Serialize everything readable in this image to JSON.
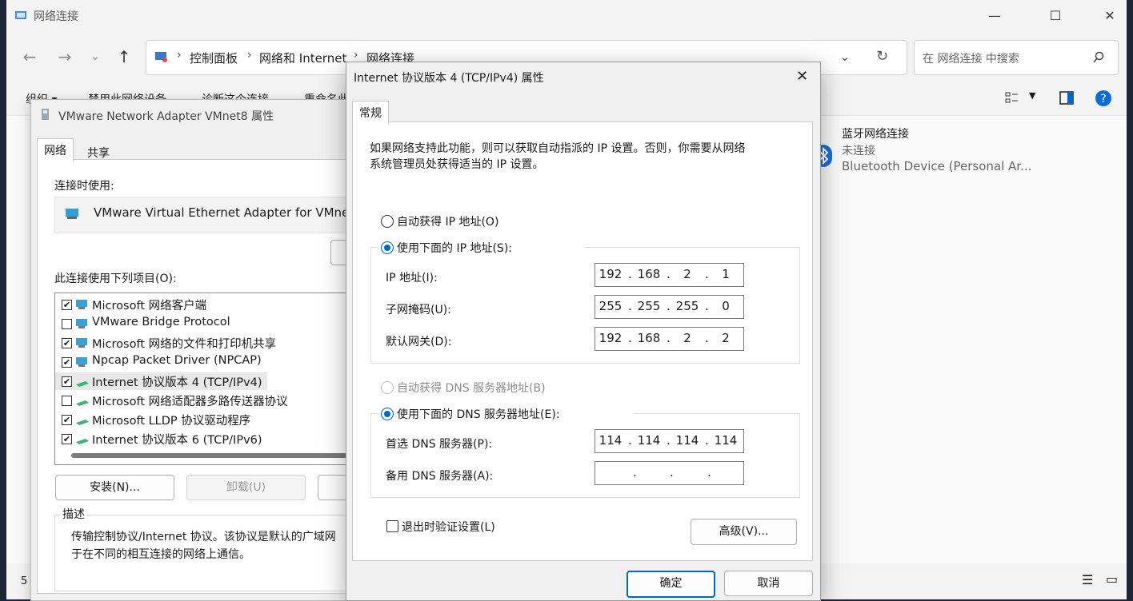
{
  "explorer": {
    "title": "网络连接",
    "breadcrumb": [
      "控制面板",
      "网络和 Internet",
      "网络连接"
    ],
    "search_placeholder": "在 网络连接 中搜索",
    "commands": [
      "组织 ▾",
      "禁用此网络设备",
      "诊断这个连接",
      "重命名此"
    ],
    "bluetooth_item": {
      "name": "蓝牙网络连接",
      "status": "未连接",
      "device": "Bluetooth Device (Personal Ar..."
    },
    "status_count": "5"
  },
  "vmnet8_dialog": {
    "title": "VMware Network Adapter VMnet8 属性",
    "tabs": [
      "网络",
      "共享"
    ],
    "connect_using_label": "连接时使用:",
    "adapter_name": "VMware Virtual Ethernet Adapter for VMnet",
    "items_label": "此连接使用下列项目(O):",
    "items": [
      {
        "label": "Microsoft 网络客户端",
        "checked": true
      },
      {
        "label": "VMware Bridge Protocol",
        "checked": false
      },
      {
        "label": "Microsoft 网络的文件和打印机共享",
        "checked": true
      },
      {
        "label": "Npcap Packet Driver (NPCAP)",
        "checked": true
      },
      {
        "label": "Internet 协议版本 4 (TCP/IPv4)",
        "checked": true
      },
      {
        "label": "Microsoft 网络适配器多路传送器协议",
        "checked": false
      },
      {
        "label": "Microsoft LLDP 协议驱动程序",
        "checked": true
      },
      {
        "label": "Internet 协议版本 6 (TCP/IPv6)",
        "checked": true
      }
    ],
    "install_button": "安装(N)...",
    "uninstall_button": "卸载(U)",
    "description_title": "描述",
    "description_line1": "传输控制协议/Internet 协议。该协议是默认的广域网",
    "description_line2": "于在不同的相互连接的网络上通信。"
  },
  "ipv4_dialog": {
    "title": "Internet 协议版本 4 (TCP/IPv4) 属性",
    "close_icon": "✕",
    "tab": "常规",
    "intro_line1": "如果网络支持此功能，则可以获取自动指派的 IP 设置。否则，你需要从网络",
    "intro_line2": "系统管理员处获得适当的 IP 设置。",
    "auto_ip_label": "自动获得 IP 地址(O)",
    "manual_ip_label": "使用下面的 IP 地址(S):",
    "ip_label": "IP 地址(I):",
    "ip_octets": [
      "192",
      "168",
      "2",
      "1"
    ],
    "mask_label": "子网掩码(U):",
    "mask_octets": [
      "255",
      "255",
      "255",
      "0"
    ],
    "gateway_label": "默认网关(D):",
    "gateway_octets": [
      "192",
      "168",
      "2",
      "2"
    ],
    "auto_dns_label": "自动获得 DNS 服务器地址(B)",
    "manual_dns_label": "使用下面的 DNS 服务器地址(E):",
    "preferred_dns_label": "首选 DNS 服务器(P):",
    "preferred_dns_octets": [
      "114",
      "114",
      "114",
      "114"
    ],
    "alternate_dns_label": "备用 DNS 服务器(A):",
    "alternate_dns_octets": [
      "",
      "",
      "",
      ""
    ],
    "validate_label": "退出时验证设置(L)",
    "advanced_button": "高级(V)...",
    "ok_button": "确定",
    "cancel_button": "取消",
    "selected": {
      "ip_mode": "manual",
      "dns_mode": "manual",
      "validate_on_exit": false
    }
  },
  "colors": {
    "accent": "#0067c0",
    "help": "#0a6ed1"
  }
}
